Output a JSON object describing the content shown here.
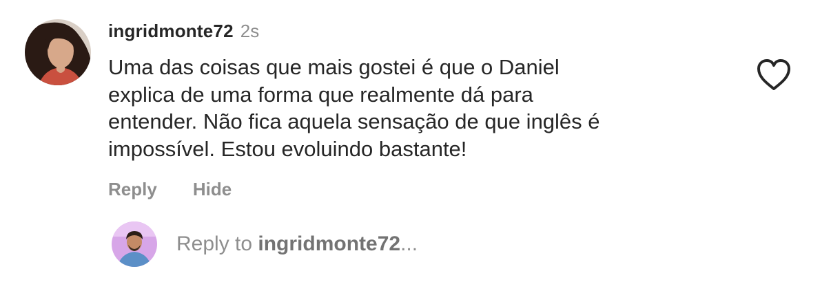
{
  "comment": {
    "username": "ingridmonte72",
    "timestamp": "2s",
    "lines": [
      "Uma das coisas que mais gostei é que o Daniel",
      "explica de uma forma que realmente dá para",
      "entender. Não fica aquela sensação de que inglês é",
      "impossível. Estou evoluindo bastante!"
    ],
    "like_icon": "heart-outline-icon",
    "actions": {
      "reply": "Reply",
      "hide": "Hide"
    }
  },
  "reply_box": {
    "prefix": "Reply to ",
    "target": "ingridmonte72",
    "suffix": "..."
  },
  "colors": {
    "text": "#262626",
    "secondary": "#8e8e8e",
    "background": "#ffffff"
  }
}
